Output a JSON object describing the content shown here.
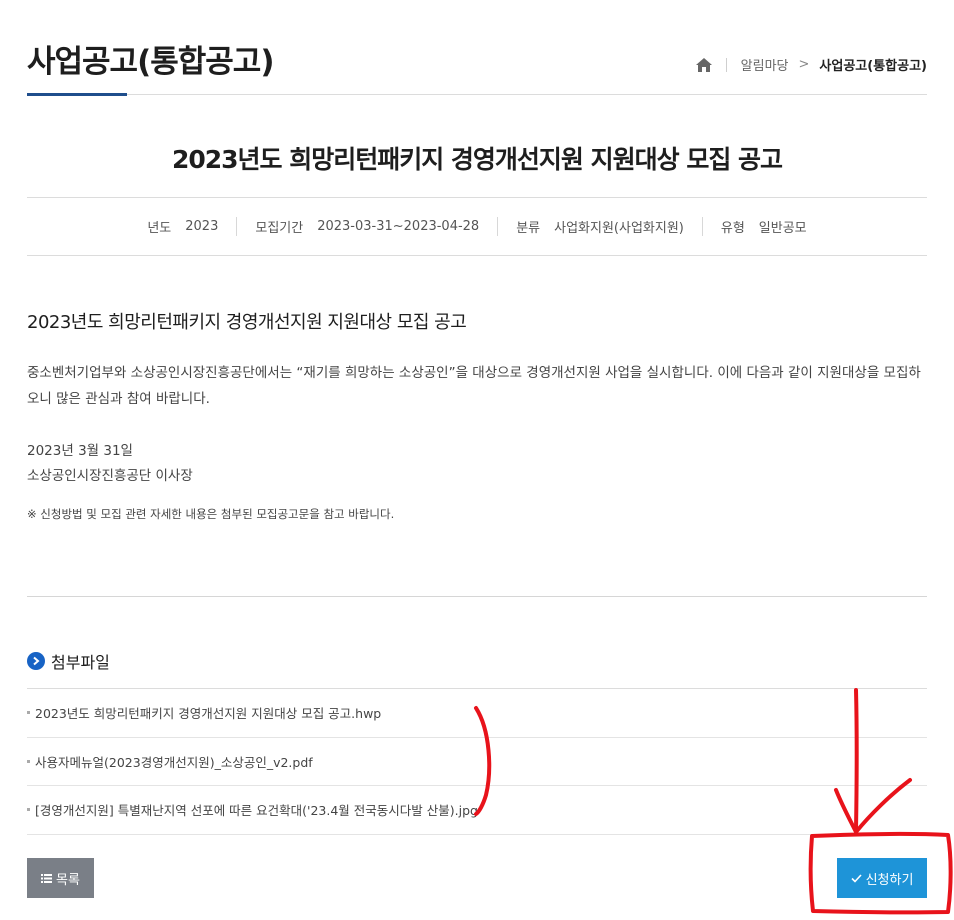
{
  "header": {
    "page_title": "사업공고(통합공고)",
    "breadcrumb": {
      "home_icon": "home-icon",
      "level1": "알림마당",
      "separator": ">",
      "current": "사업공고(통합공고)"
    }
  },
  "post": {
    "title": "2023년도 희망리턴패키지 경영개선지원 지원대상 모집 공고",
    "meta": [
      {
        "key": "년도",
        "value": "2023"
      },
      {
        "key": "모집기간",
        "value": "2023-03-31~2023-04-28"
      },
      {
        "key": "분류",
        "value": "사업화지원(사업화지원)"
      },
      {
        "key": "유형",
        "value": "일반공모"
      }
    ],
    "heading": "2023년도 희망리턴패키지 경영개선지원 지원대상 모집 공고",
    "body": "중소벤처기업부와 소상공인시장진흥공단에서는 “재기를 희망하는 소상공인”을 대상으로 경영개선지원 사업을 실시합니다. 이에 다음과 같이 지원대상을 모집하오니 많은 관심과 참여 바랍니다.",
    "date_line": "2023년 3월 31일",
    "signer": "소상공인시장진흥공단 이사장",
    "note": "※ 신청방법 및 모집 관련 자세한 내용은 첨부된 모집공고문을 참고 바랍니다."
  },
  "attachments": {
    "title": "첨부파일",
    "icon": "chevron-right-circle-icon",
    "files": [
      "2023년도 희망리턴패키지 경영개선지원 지원대상 모집 공고.hwp",
      "사용자메뉴얼(2023경영개선지원)_소상공인_v2.pdf",
      "[경영개선지원] 특별재난지역 선포에 따른 요건확대('23.4월 전국동시다발 산불).jpg"
    ]
  },
  "buttons": {
    "list_label": "목록",
    "list_icon": "list-icon",
    "apply_label": "신청하기",
    "apply_icon": "check-icon"
  },
  "annotation_color": "#e8131b"
}
